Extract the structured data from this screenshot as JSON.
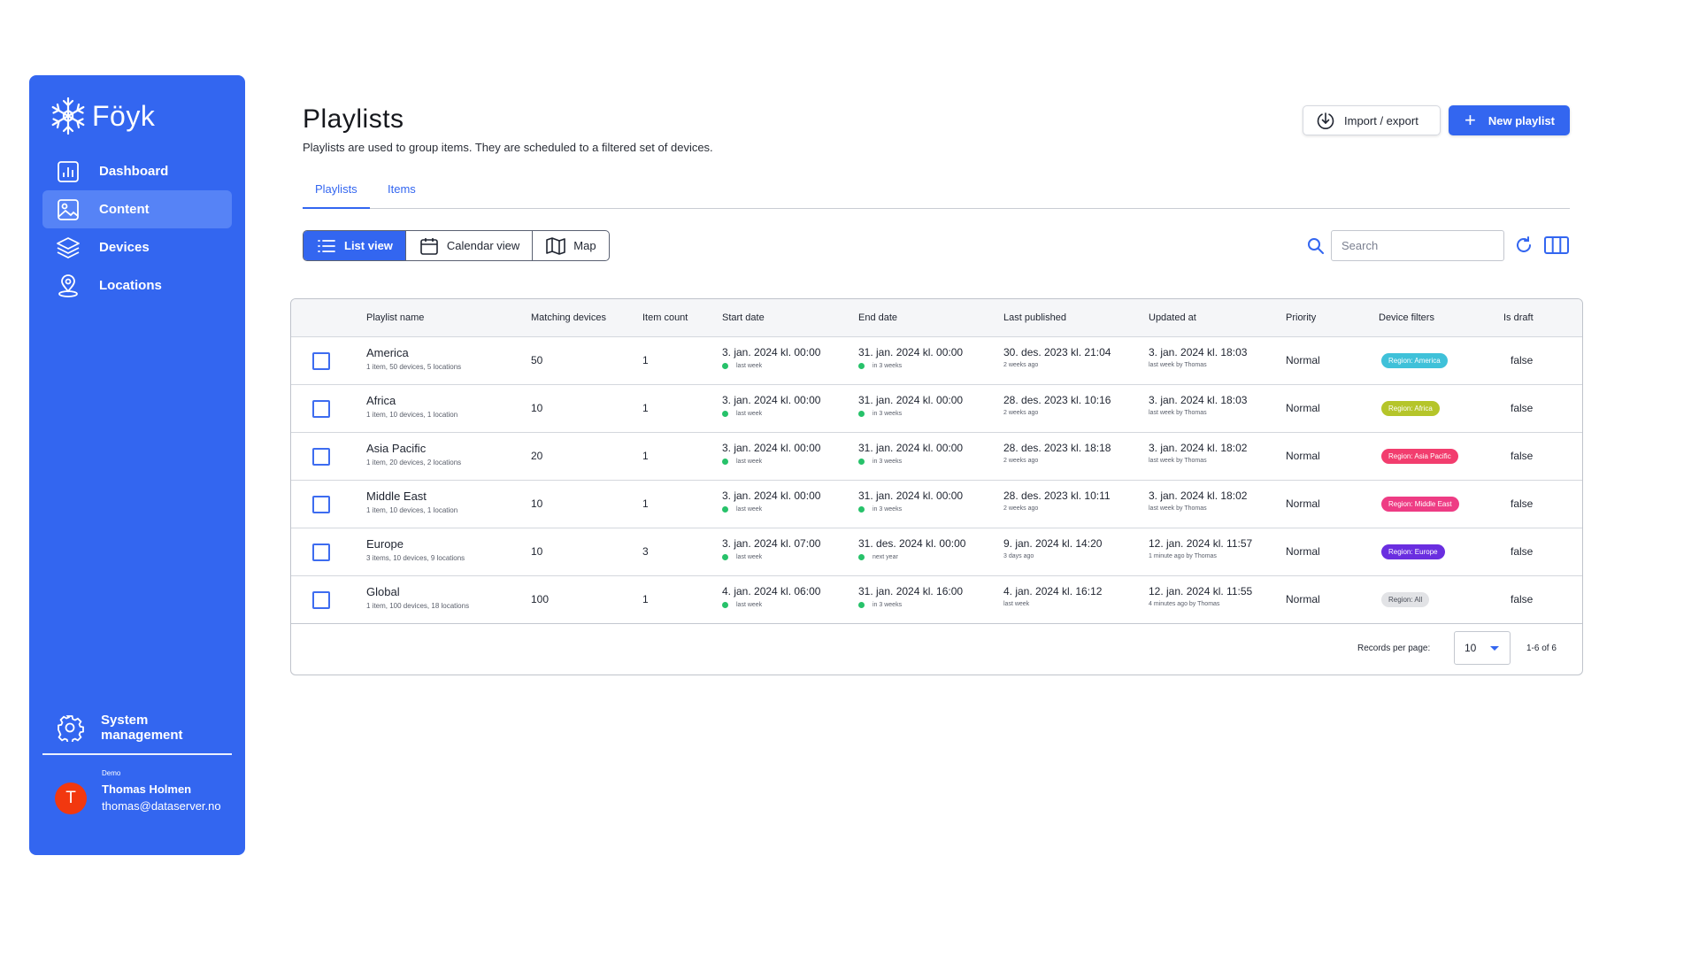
{
  "sidebar": {
    "brand": "Föyk",
    "items": [
      {
        "label": "Dashboard",
        "icon": "chart-icon"
      },
      {
        "label": "Content",
        "icon": "image-icon",
        "active": true
      },
      {
        "label": "Devices",
        "icon": "layers-icon"
      },
      {
        "label": "Locations",
        "icon": "location-pin-icon"
      }
    ],
    "system_label": "System management",
    "user": {
      "org": "Demo",
      "name": "Thomas Holmen",
      "email": "thomas@dataserver.no",
      "initial": "T"
    }
  },
  "header": {
    "title": "Playlists",
    "description": "Playlists are used to group items. They are scheduled to a filtered set of devices.",
    "import_label": "Import / export",
    "new_label": "New playlist"
  },
  "tabs": [
    "Playlists",
    "Items"
  ],
  "views": [
    "List view",
    "Calendar view",
    "Map"
  ],
  "search": {
    "placeholder": "Search"
  },
  "table": {
    "columns": [
      "Playlist name",
      "Matching devices",
      "Item count",
      "Start date",
      "End date",
      "Last published",
      "Updated at",
      "Priority",
      "Device filters",
      "Is draft"
    ],
    "rows": [
      {
        "name": "America",
        "meta": "1 item, 50 devices, 5 locations",
        "devices": "50",
        "items": "1",
        "start": "3. jan. 2024 kl. 00:00",
        "start_rel": "last week",
        "end": "31. jan. 2024 kl. 00:00",
        "end_rel": "in 3 weeks",
        "published": "30. des. 2023 kl. 21:04",
        "published_rel": "2 weeks ago",
        "updated": "3. jan. 2024 kl. 18:03",
        "updated_rel": "last week by Thomas",
        "priority": "Normal",
        "filter": "Region: America",
        "filter_color": "#3fc1d9",
        "draft": "false"
      },
      {
        "name": "Africa",
        "meta": "1 item, 10 devices, 1 location",
        "devices": "10",
        "items": "1",
        "start": "3. jan. 2024 kl. 00:00",
        "start_rel": "last week",
        "end": "31. jan. 2024 kl. 00:00",
        "end_rel": "in 3 weeks",
        "published": "28. des. 2023 kl. 10:16",
        "published_rel": "2 weeks ago",
        "updated": "3. jan. 2024 kl. 18:03",
        "updated_rel": "last week by Thomas",
        "priority": "Normal",
        "filter": "Region: Africa",
        "filter_color": "#b5c52a",
        "draft": "false"
      },
      {
        "name": "Asia Pacific",
        "meta": "1 item, 20 devices, 2 locations",
        "devices": "20",
        "items": "1",
        "start": "3. jan. 2024 kl. 00:00",
        "start_rel": "last week",
        "end": "31. jan. 2024 kl. 00:00",
        "end_rel": "in 3 weeks",
        "published": "28. des. 2023 kl. 18:18",
        "published_rel": "2 weeks ago",
        "updated": "3. jan. 2024 kl. 18:02",
        "updated_rel": "last week by Thomas",
        "priority": "Normal",
        "filter": "Region: Asia Pacific",
        "filter_color": "#f23d6e",
        "draft": "false"
      },
      {
        "name": "Middle East",
        "meta": "1 item, 10 devices, 1 location",
        "devices": "10",
        "items": "1",
        "start": "3. jan. 2024 kl. 00:00",
        "start_rel": "last week",
        "end": "31. jan. 2024 kl. 00:00",
        "end_rel": "in 3 weeks",
        "published": "28. des. 2023 kl. 10:11",
        "published_rel": "2 weeks ago",
        "updated": "3. jan. 2024 kl. 18:02",
        "updated_rel": "last week by Thomas",
        "priority": "Normal",
        "filter": "Region: Middle East",
        "filter_color": "#ee3c84",
        "draft": "false"
      },
      {
        "name": "Europe",
        "meta": "3 items, 10 devices, 9 locations",
        "devices": "10",
        "items": "3",
        "start": "3. jan. 2024 kl. 07:00",
        "start_rel": "last week",
        "end": "31. des. 2024 kl. 00:00",
        "end_rel": "next year",
        "published": "9. jan. 2024 kl. 14:20",
        "published_rel": "3 days ago",
        "updated": "12. jan. 2024 kl. 11:57",
        "updated_rel": "1 minute ago by Thomas",
        "priority": "Normal",
        "filter": "Region: Europe",
        "filter_color": "#6a2ee0",
        "draft": "false"
      },
      {
        "name": "Global",
        "meta": "1 item, 100 devices, 18 locations",
        "devices": "100",
        "items": "1",
        "start": "4. jan. 2024 kl. 06:00",
        "start_rel": "last week",
        "end": "31. jan. 2024 kl. 16:00",
        "end_rel": "in 3 weeks",
        "published": "4. jan. 2024 kl. 16:12",
        "published_rel": "last week",
        "updated": "12. jan. 2024 kl. 11:55",
        "updated_rel": "4 minutes ago by Thomas",
        "priority": "Normal",
        "filter": "Region: All",
        "filter_color": "#e2e3e6",
        "filter_text_color": "#4a4e58",
        "draft": "false"
      }
    ]
  },
  "pagination": {
    "label": "Records per page:",
    "value": "10",
    "range": "1-6 of 6"
  },
  "colors": {
    "accent": "#3366f0",
    "active_nav": "#5683f6",
    "status_dot": "#27c26a",
    "avatar": "#f2380f"
  }
}
